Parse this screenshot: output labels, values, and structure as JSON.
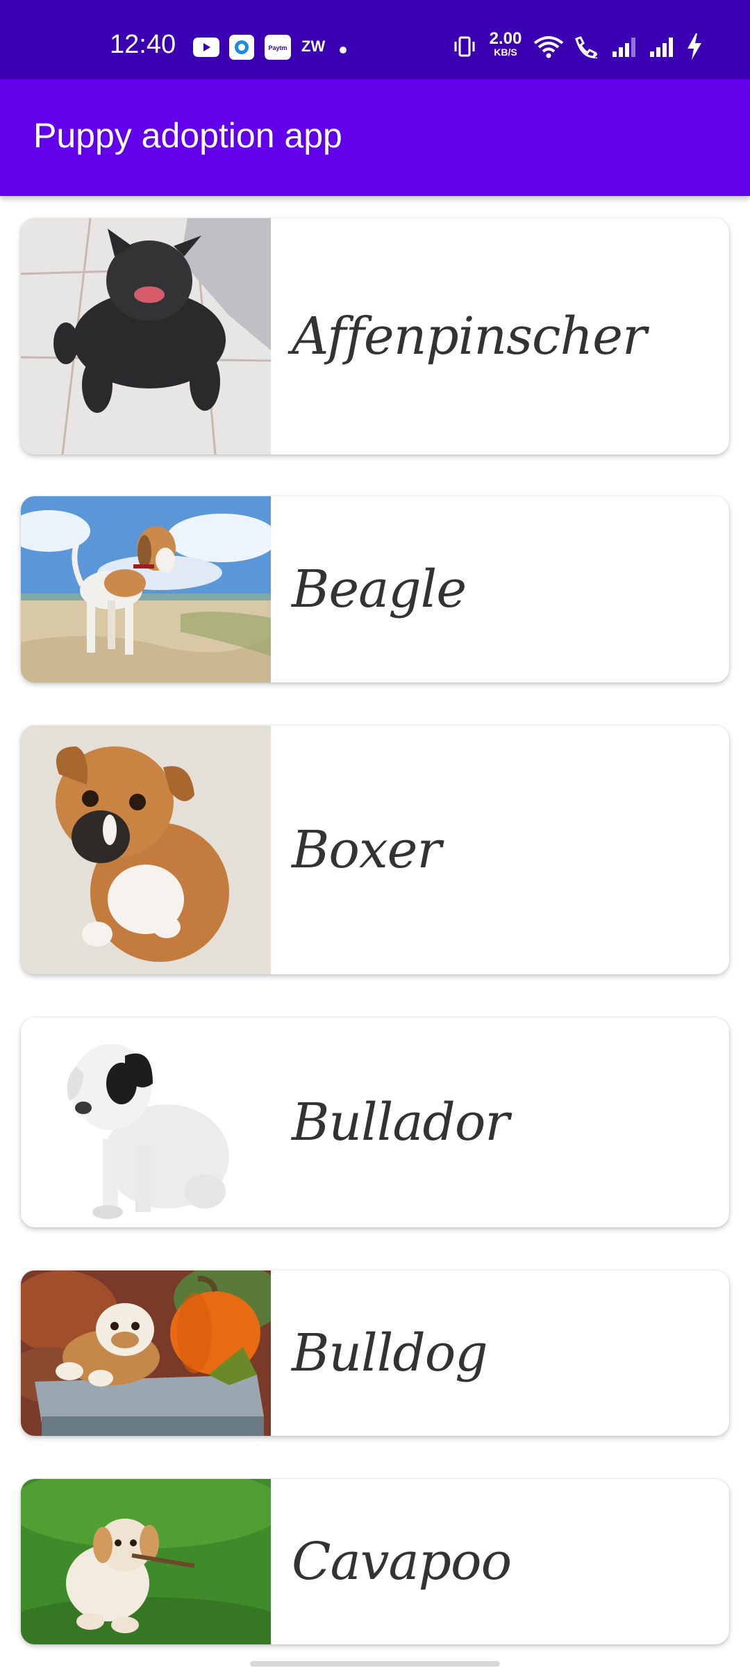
{
  "status_bar": {
    "time": "12:40",
    "app_icons": [
      "youtube-icon",
      "messenger-icon",
      "paytm-icon",
      "zw-icon",
      "dot-icon"
    ],
    "paytm_label": "Paytm",
    "zw_label": "ZW",
    "net_speed_value": "2.00",
    "net_speed_unit": "KB/S",
    "system_icons": [
      "vibrate-icon",
      "wifi-icon",
      "wifi-calling-icon",
      "signal-icon",
      "signal-icon",
      "charging-icon"
    ]
  },
  "app_bar": {
    "title": "Puppy adoption app",
    "color": "#6200ea",
    "status_color": "#3c00b3"
  },
  "puppies": [
    {
      "name": "Affenpinscher",
      "image": "affenpinscher-photo"
    },
    {
      "name": "Beagle",
      "image": "beagle-photo"
    },
    {
      "name": "Boxer",
      "image": "boxer-photo"
    },
    {
      "name": "Bullador",
      "image": "bullador-photo"
    },
    {
      "name": "Bulldog",
      "image": "bulldog-photo"
    },
    {
      "name": "Cavapoo",
      "image": "cavapoo-photo"
    }
  ]
}
